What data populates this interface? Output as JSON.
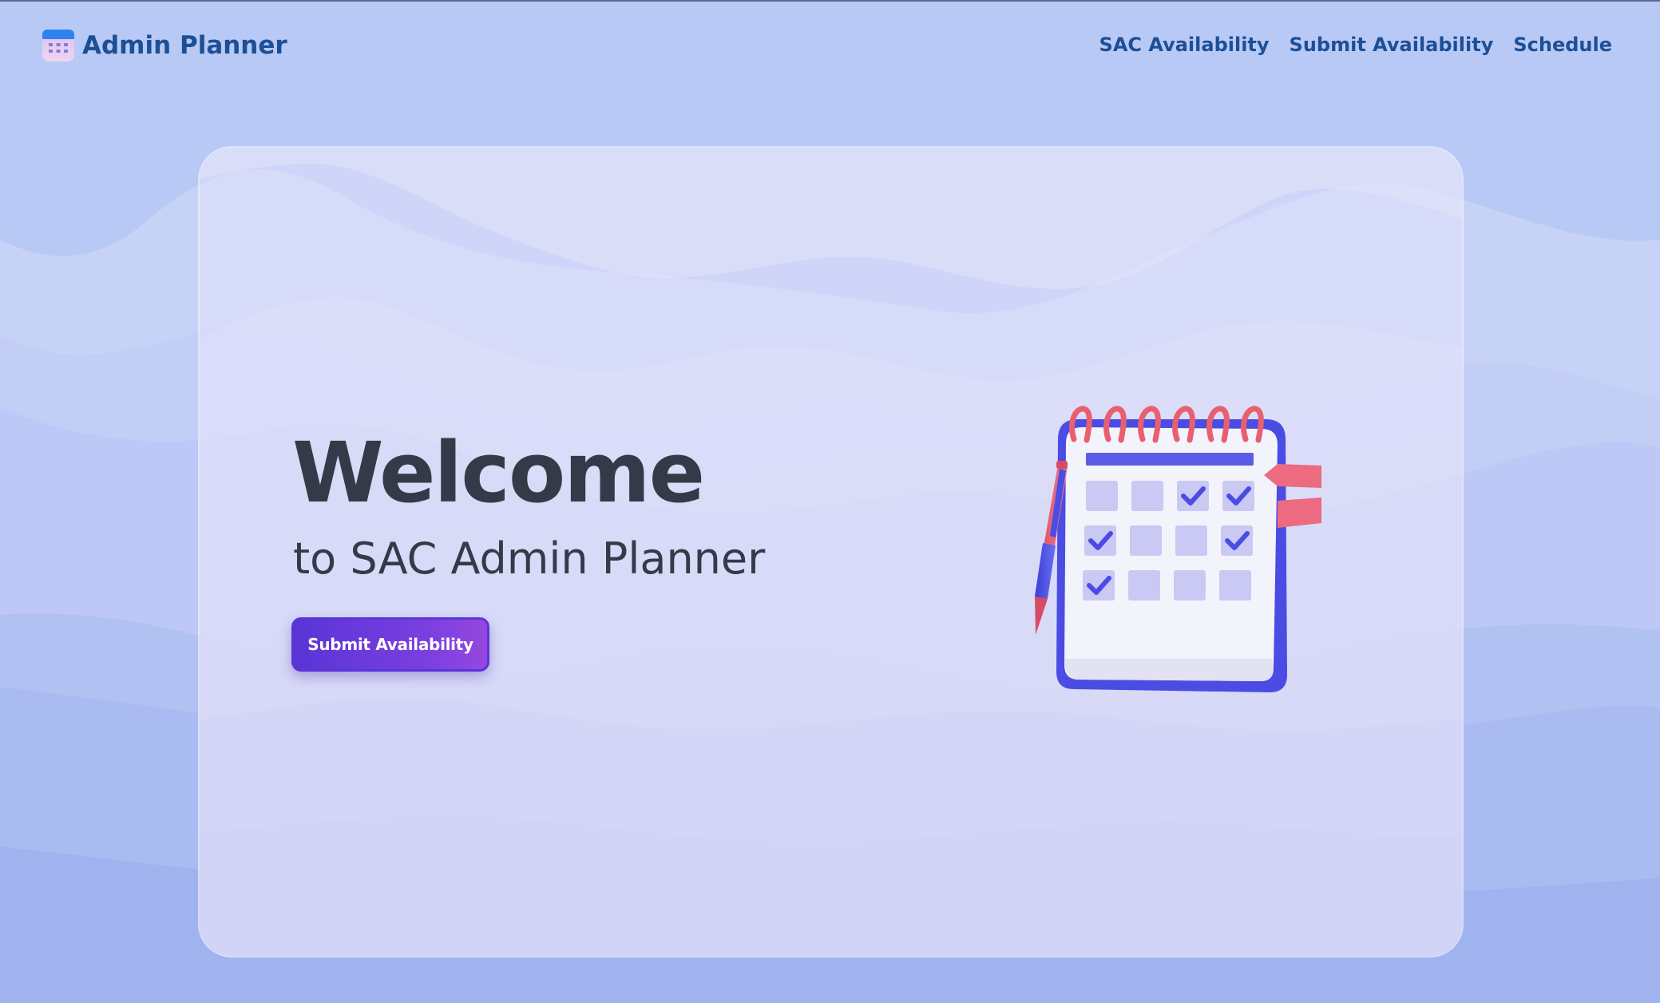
{
  "brand": {
    "name": "Admin Planner",
    "icon": "calendar-grid-icon"
  },
  "nav": {
    "links": [
      {
        "label": "SAC Availability"
      },
      {
        "label": "Submit Availability"
      },
      {
        "label": "Schedule"
      }
    ]
  },
  "hero": {
    "title": "Welcome",
    "subtitle": "to SAC Admin Planner",
    "cta_label": "Submit Availability",
    "illustration": "calendar-with-pen-illustration"
  },
  "colors": {
    "background": "#b6c8f4",
    "brand_text": "#1c4f96",
    "heading_text": "#353a48",
    "button_start": "#5a34d6",
    "button_end": "#9648df",
    "calendar_blue": "#4a4fe0",
    "calendar_rings": "#e8606f"
  }
}
